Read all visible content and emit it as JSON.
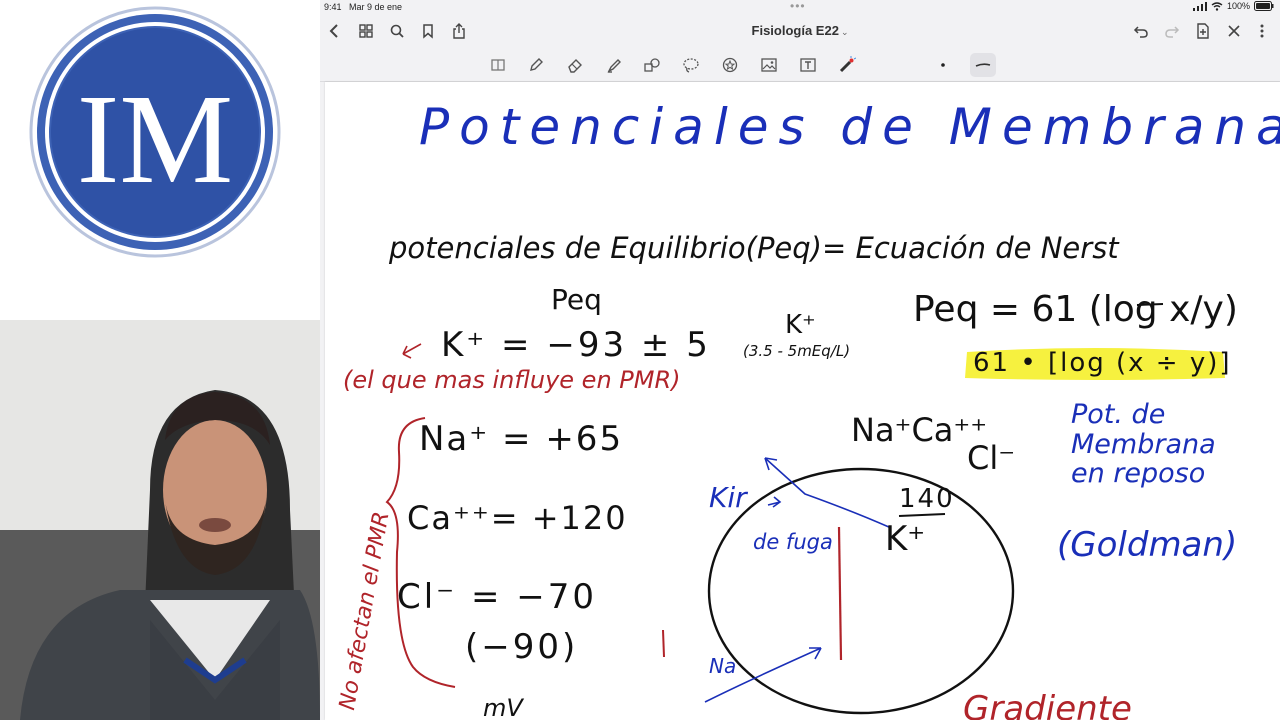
{
  "logo": {
    "text": "IM",
    "colors": {
      "ring": "#3d62b5",
      "disc": "#2f52a6",
      "letters": "#ffffff"
    }
  },
  "status_bar": {
    "time": "9:41",
    "date": "Mar 9 de ene",
    "battery": "100%"
  },
  "nav": {
    "title": "Fisiología E22",
    "title_chevron": "⌄"
  },
  "toolbar": {
    "tools": [
      "pages-icon",
      "pen-icon",
      "eraser-icon",
      "highlighter-icon",
      "shapes-icon",
      "lasso-icon",
      "sticker-icon",
      "image-icon",
      "textbox-icon",
      "laser-pointer-icon"
    ]
  },
  "note": {
    "title": "Potenciales de Membrana",
    "equilibrium_heading": "potenciales de Equilibrio(Peq)= Ecuación de Nerst",
    "peq_label": "Peq",
    "k_line": "K⁺ = −93 ± 5",
    "k_note": "(el que mas influye en PMR)",
    "k_conc_ion": "K⁺",
    "k_conc": "(3.5 - 5mEq/L)",
    "formula": "Peq = 61 (log x/y)",
    "formula_alt": "61 • [log (x ÷ y)]",
    "na_line": "Na⁺ = +65",
    "ca_line": "Ca⁺⁺= +120",
    "cl_line": "Cl⁻ = −70",
    "cl_alt": "(−90)",
    "side_note": "No afectan el PMR",
    "unit": "mV",
    "ions_outside": "Na⁺Ca⁺⁺",
    "cl_outside": "Cl⁻",
    "cell_conc": "140",
    "cell_ion": "K⁺",
    "kir_label": "Kir",
    "fuga_label": "de fuga",
    "na_small": "Na",
    "resting_title": "Pot. de\nMembrana\nen reposo",
    "goldman": "(Goldman)",
    "gradient": "Gradiente",
    "colors": {
      "blue_ink": "#1a2fb8",
      "black_ink": "#111111",
      "red_ink": "#b0242a",
      "highlight": "#f5f035"
    }
  }
}
